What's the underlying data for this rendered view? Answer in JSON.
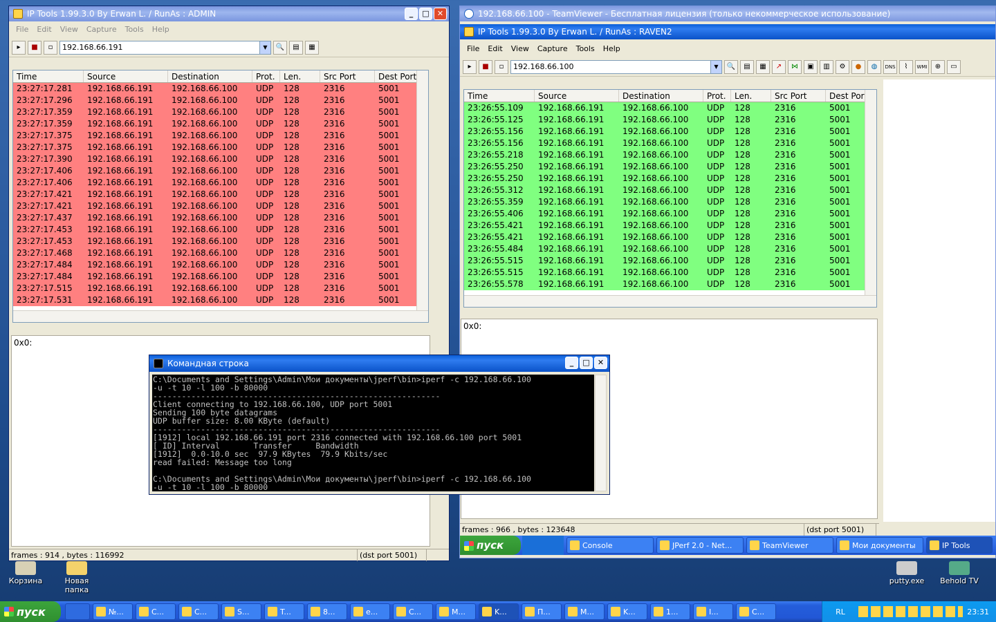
{
  "left": {
    "title": "IP Tools 1.99.3.0 By Erwan L. / RunAs : ADMIN",
    "menu": [
      "File",
      "Edit",
      "View",
      "Capture",
      "Tools",
      "Help"
    ],
    "address": "192.168.66.191",
    "columns": [
      "Time",
      "Source",
      "Destination",
      "Prot.",
      "Len.",
      "Src Port",
      "Dest Port"
    ],
    "rows": [
      [
        "23:27:17.281",
        "192.168.66.191",
        "192.168.66.100",
        "UDP",
        "128",
        "2316",
        "5001"
      ],
      [
        "23:27:17.296",
        "192.168.66.191",
        "192.168.66.100",
        "UDP",
        "128",
        "2316",
        "5001"
      ],
      [
        "23:27:17.359",
        "192.168.66.191",
        "192.168.66.100",
        "UDP",
        "128",
        "2316",
        "5001"
      ],
      [
        "23:27:17.359",
        "192.168.66.191",
        "192.168.66.100",
        "UDP",
        "128",
        "2316",
        "5001"
      ],
      [
        "23:27:17.375",
        "192.168.66.191",
        "192.168.66.100",
        "UDP",
        "128",
        "2316",
        "5001"
      ],
      [
        "23:27:17.375",
        "192.168.66.191",
        "192.168.66.100",
        "UDP",
        "128",
        "2316",
        "5001"
      ],
      [
        "23:27:17.390",
        "192.168.66.191",
        "192.168.66.100",
        "UDP",
        "128",
        "2316",
        "5001"
      ],
      [
        "23:27:17.406",
        "192.168.66.191",
        "192.168.66.100",
        "UDP",
        "128",
        "2316",
        "5001"
      ],
      [
        "23:27:17.406",
        "192.168.66.191",
        "192.168.66.100",
        "UDP",
        "128",
        "2316",
        "5001"
      ],
      [
        "23:27:17.421",
        "192.168.66.191",
        "192.168.66.100",
        "UDP",
        "128",
        "2316",
        "5001"
      ],
      [
        "23:27:17.421",
        "192.168.66.191",
        "192.168.66.100",
        "UDP",
        "128",
        "2316",
        "5001"
      ],
      [
        "23:27:17.437",
        "192.168.66.191",
        "192.168.66.100",
        "UDP",
        "128",
        "2316",
        "5001"
      ],
      [
        "23:27:17.453",
        "192.168.66.191",
        "192.168.66.100",
        "UDP",
        "128",
        "2316",
        "5001"
      ],
      [
        "23:27:17.453",
        "192.168.66.191",
        "192.168.66.100",
        "UDP",
        "128",
        "2316",
        "5001"
      ],
      [
        "23:27:17.468",
        "192.168.66.191",
        "192.168.66.100",
        "UDP",
        "128",
        "2316",
        "5001"
      ],
      [
        "23:27:17.484",
        "192.168.66.191",
        "192.168.66.100",
        "UDP",
        "128",
        "2316",
        "5001"
      ],
      [
        "23:27:17.484",
        "192.168.66.191",
        "192.168.66.100",
        "UDP",
        "128",
        "2316",
        "5001"
      ],
      [
        "23:27:17.515",
        "192.168.66.191",
        "192.168.66.100",
        "UDP",
        "128",
        "2316",
        "5001"
      ],
      [
        "23:27:17.531",
        "192.168.66.191",
        "192.168.66.100",
        "UDP",
        "128",
        "2316",
        "5001"
      ]
    ],
    "detail": "0x0:",
    "status": [
      "frames : 914 , bytes : 116992",
      "(dst port 5001)"
    ],
    "row_color": "#ff8080"
  },
  "right": {
    "outer_title": "192.168.66.100 - TeamViewer - Бесплатная лицензия (только некоммерческое использование)",
    "title": "IP Tools 1.99.3.0 By Erwan L. / RunAs : RAVEN2",
    "menu": [
      "File",
      "Edit",
      "View",
      "Capture",
      "Tools",
      "Help"
    ],
    "address": "192.168.66.100",
    "columns": [
      "Time",
      "Source",
      "Destination",
      "Prot.",
      "Len.",
      "Src Port",
      "Dest Port"
    ],
    "rows": [
      [
        "23:26:55.109",
        "192.168.66.191",
        "192.168.66.100",
        "UDP",
        "128",
        "2316",
        "5001"
      ],
      [
        "23:26:55.125",
        "192.168.66.191",
        "192.168.66.100",
        "UDP",
        "128",
        "2316",
        "5001"
      ],
      [
        "23:26:55.156",
        "192.168.66.191",
        "192.168.66.100",
        "UDP",
        "128",
        "2316",
        "5001"
      ],
      [
        "23:26:55.156",
        "192.168.66.191",
        "192.168.66.100",
        "UDP",
        "128",
        "2316",
        "5001"
      ],
      [
        "23:26:55.218",
        "192.168.66.191",
        "192.168.66.100",
        "UDP",
        "128",
        "2316",
        "5001"
      ],
      [
        "23:26:55.250",
        "192.168.66.191",
        "192.168.66.100",
        "UDP",
        "128",
        "2316",
        "5001"
      ],
      [
        "23:26:55.250",
        "192.168.66.191",
        "192.168.66.100",
        "UDP",
        "128",
        "2316",
        "5001"
      ],
      [
        "23:26:55.312",
        "192.168.66.191",
        "192.168.66.100",
        "UDP",
        "128",
        "2316",
        "5001"
      ],
      [
        "23:26:55.359",
        "192.168.66.191",
        "192.168.66.100",
        "UDP",
        "128",
        "2316",
        "5001"
      ],
      [
        "23:26:55.406",
        "192.168.66.191",
        "192.168.66.100",
        "UDP",
        "128",
        "2316",
        "5001"
      ],
      [
        "23:26:55.421",
        "192.168.66.191",
        "192.168.66.100",
        "UDP",
        "128",
        "2316",
        "5001"
      ],
      [
        "23:26:55.421",
        "192.168.66.191",
        "192.168.66.100",
        "UDP",
        "128",
        "2316",
        "5001"
      ],
      [
        "23:26:55.484",
        "192.168.66.191",
        "192.168.66.100",
        "UDP",
        "128",
        "2316",
        "5001"
      ],
      [
        "23:26:55.515",
        "192.168.66.191",
        "192.168.66.100",
        "UDP",
        "128",
        "2316",
        "5001"
      ],
      [
        "23:26:55.515",
        "192.168.66.191",
        "192.168.66.100",
        "UDP",
        "128",
        "2316",
        "5001"
      ],
      [
        "23:26:55.578",
        "192.168.66.191",
        "192.168.66.100",
        "UDP",
        "128",
        "2316",
        "5001"
      ]
    ],
    "detail": "0x0:",
    "status": [
      "frames : 966 , bytes : 123648",
      "(dst port 5001)"
    ],
    "row_color": "#80ff80",
    "remote_taskbar": {
      "start": "пуск",
      "items": [
        "Console",
        "JPerf 2.0 - Net...",
        "TeamViewer",
        "Мои документы",
        "IP Tools"
      ]
    }
  },
  "cmd": {
    "title": "Командная строка",
    "lines": [
      "C:\\Documents and Settings\\Admin\\Мои документы\\jperf\\bin>iperf -c 192.168.66.100",
      "-u -t 10 -l 100 -b 80000",
      "------------------------------------------------------------",
      "Client connecting to 192.168.66.100, UDP port 5001",
      "Sending 100 byte datagrams",
      "UDP buffer size: 8.00 KByte (default)",
      "------------------------------------------------------------",
      "[1912] local 192.168.66.191 port 2316 connected with 192.168.66.100 port 5001",
      "[ ID] Interval       Transfer     Bandwidth",
      "[1912]  0.0-10.0 sec  97.9 KBytes  79.9 Kbits/sec",
      "read failed: Message too long",
      "",
      "C:\\Documents and Settings\\Admin\\Мои документы\\jperf\\bin>iperf -c 192.168.66.100",
      "-u -t 10 -l 100 -b 80000"
    ]
  },
  "desktop_icons": [
    "Корзина",
    "Новая папка",
    "putty.exe",
    "Behold TV"
  ],
  "taskbar": {
    "start": "пуск",
    "items": [
      "№...",
      "C...",
      "C...",
      "S...",
      "T...",
      "8...",
      "e...",
      "C...",
      "M...",
      "K...",
      "П...",
      "M...",
      "K...",
      "1...",
      "I...",
      "C..."
    ],
    "lang": "RL",
    "clock": "23:31"
  }
}
